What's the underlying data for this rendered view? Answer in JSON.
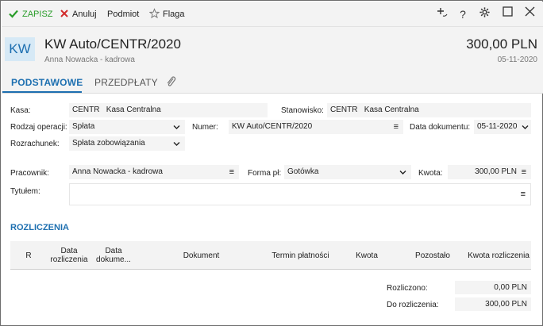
{
  "toolbar": {
    "save_label": "ZAPISZ",
    "cancel_label": "Anuluj",
    "subject_label": "Podmiot",
    "flag_label": "Flaga",
    "save_color": "#2a9d2a",
    "cancel_color": "#d22b2b"
  },
  "header": {
    "badge": "KW",
    "title": "KW Auto/CENTR/2020",
    "subtitle": "Anna Nowacka - kadrowa",
    "amount": "300,00 PLN",
    "date": "05-11-2020"
  },
  "tabs": [
    {
      "label": "PODSTAWOWE",
      "active": true
    },
    {
      "label": "PRZEDPŁATY",
      "active": false
    }
  ],
  "form": {
    "kasa_label": "Kasa:",
    "kasa_code": "CENTR",
    "kasa_name": "Kasa Centralna",
    "stanowisko_label": "Stanowisko:",
    "stanowisko_code": "CENTR",
    "stanowisko_name": "Kasa Centralna",
    "rodzaj_label": "Rodzaj operacji:",
    "rodzaj_value": "Spłata",
    "numer_label": "Numer:",
    "numer_value": "KW Auto/CENTR/2020",
    "data_label": "Data dokumentu:",
    "data_value": "05-11-2020",
    "rozrachunek_label": "Rozrachunek:",
    "rozrachunek_value": "Spłata zobowiązania",
    "pracownik_label": "Pracownik:",
    "pracownik_value": "Anna Nowacka - kadrowa",
    "forma_label": "Forma pł:",
    "forma_value": "Gotówka",
    "kwota_label": "Kwota:",
    "kwota_value": "300,00 PLN",
    "tytulem_label": "Tytułem:",
    "tytulem_value": ""
  },
  "rozliczenia": {
    "title": "ROZLICZENIA",
    "columns": [
      "R",
      "Data rozliczenia",
      "Data dokume...",
      "Dokument",
      "Termin płatności",
      "Kwota",
      "Pozostało",
      "Kwota rozliczenia"
    ],
    "rows": [],
    "rozliczono_label": "Rozliczono:",
    "rozliczono_value": "0,00 PLN",
    "do_rozliczenia_label": "Do rozliczenia:",
    "do_rozliczenia_value": "300,00 PLN"
  },
  "accent_color": "#1d6fb0"
}
